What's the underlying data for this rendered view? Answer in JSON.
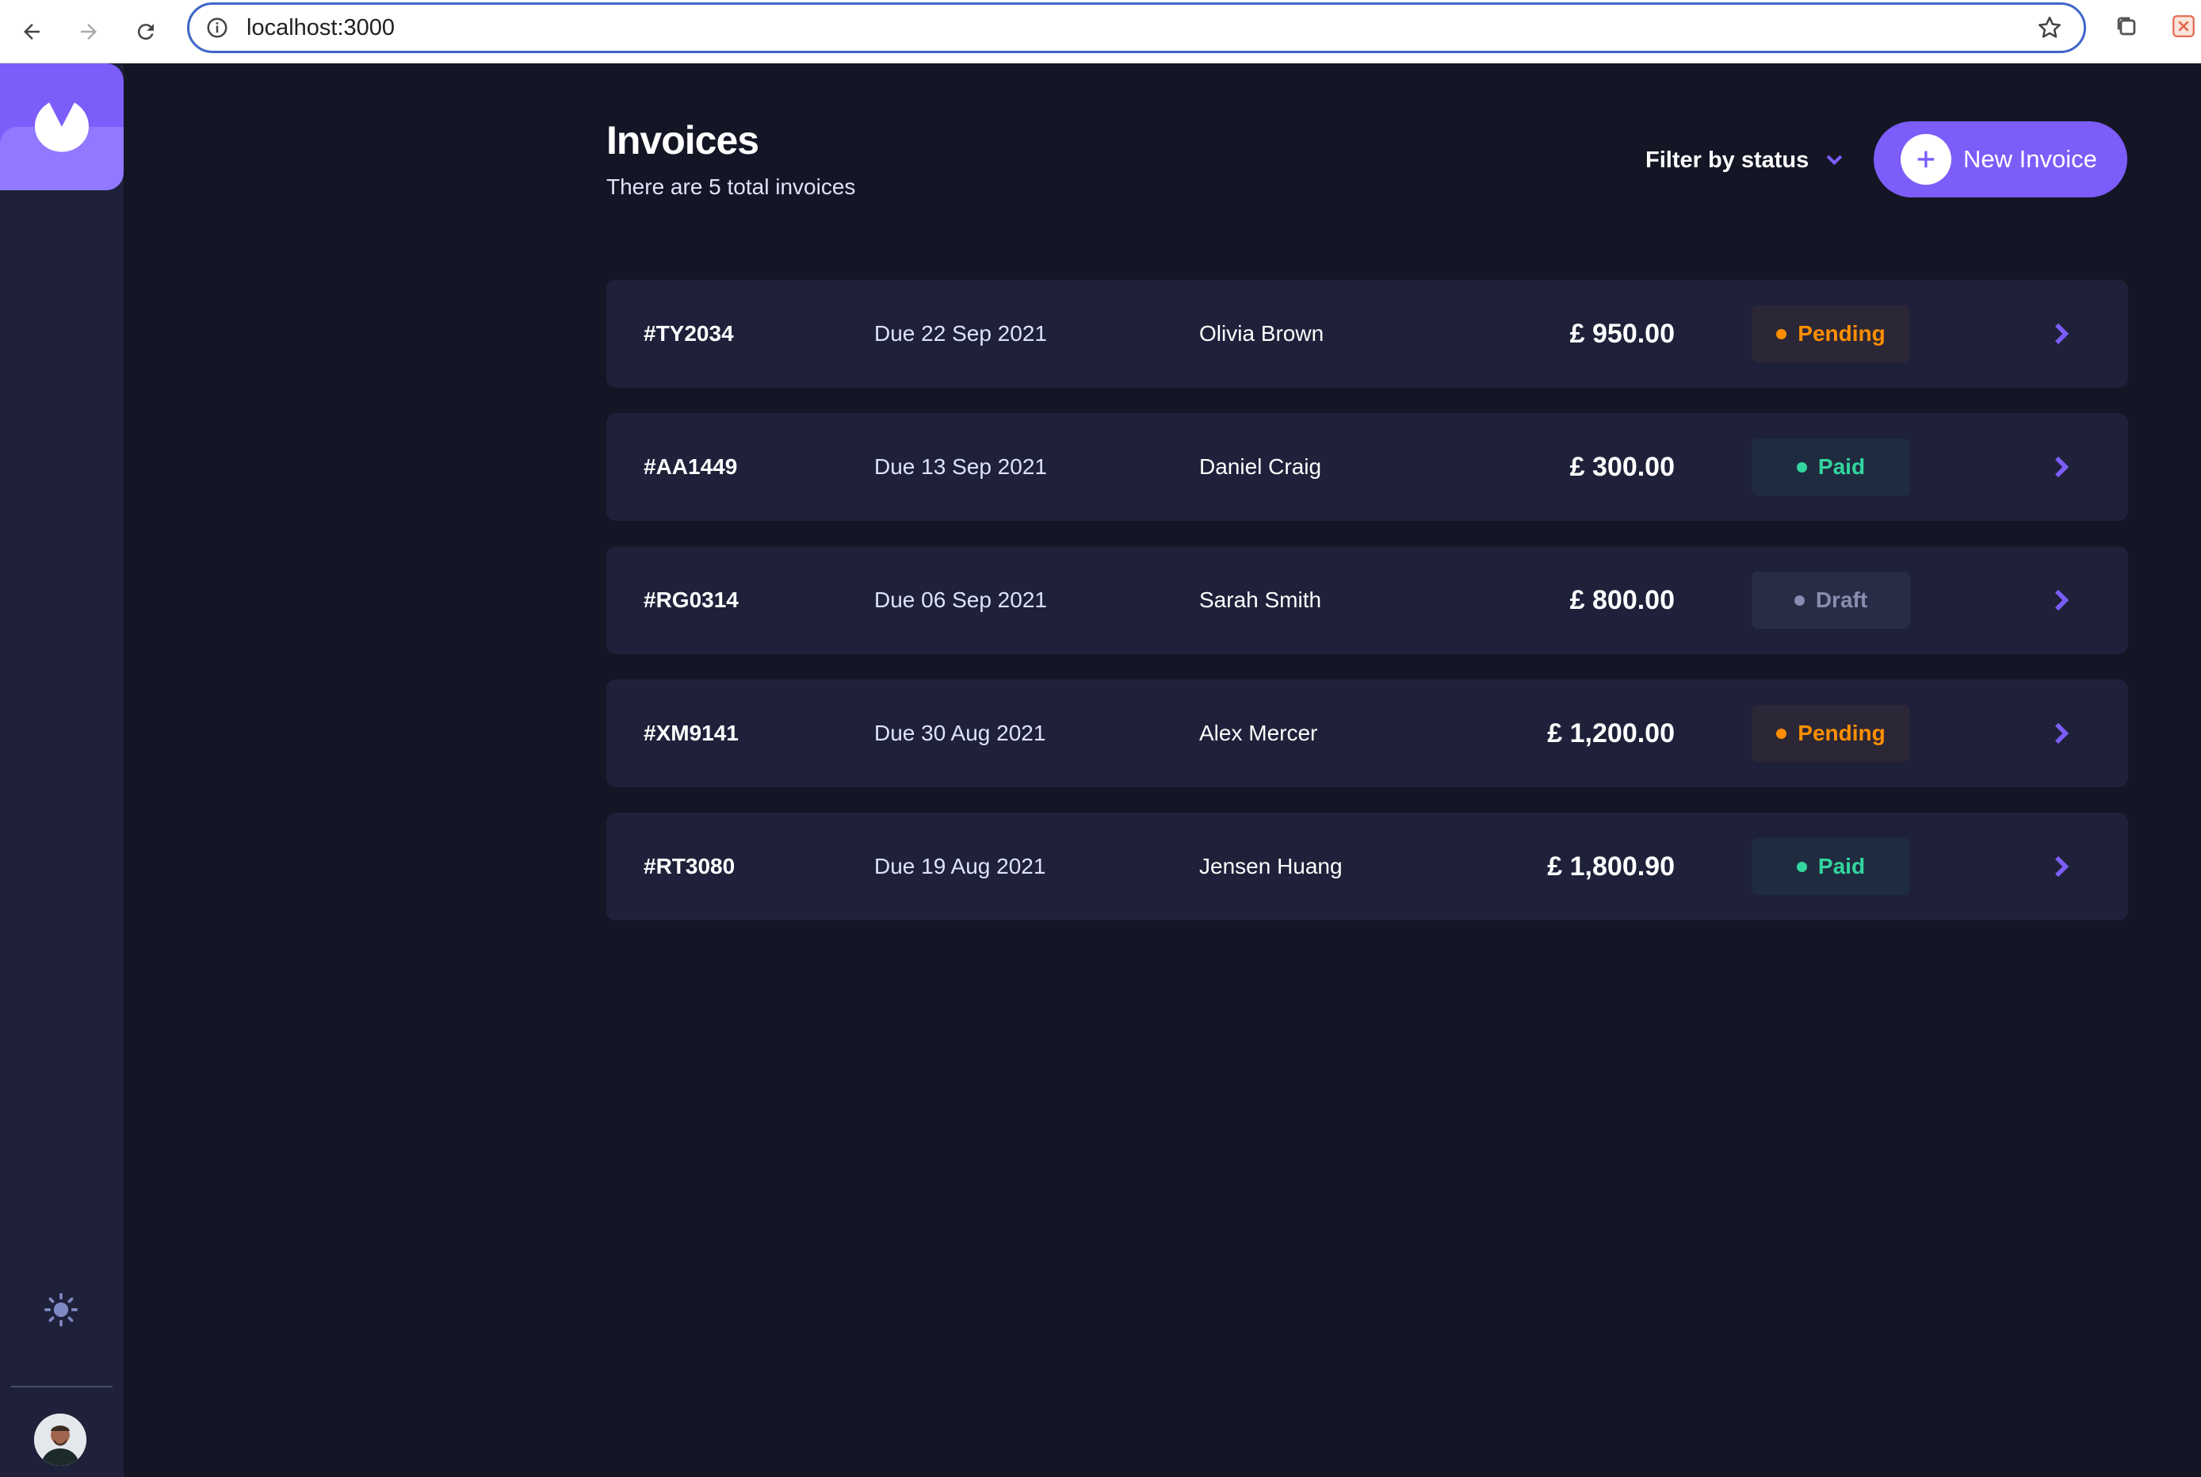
{
  "browser": {
    "url": "localhost:3000"
  },
  "header": {
    "title": "Invoices",
    "subtitle": "There are 5 total invoices",
    "filter_label": "Filter by status",
    "new_invoice_label": "New Invoice"
  },
  "invoices": [
    {
      "id_hash": "#",
      "id": "TY2034",
      "due": "Due 22 Sep 2021",
      "client": "Olivia Brown",
      "amount": "£ 950.00",
      "status": "Pending"
    },
    {
      "id_hash": "#",
      "id": "AA1449",
      "due": "Due 13 Sep 2021",
      "client": "Daniel Craig",
      "amount": "£ 300.00",
      "status": "Paid"
    },
    {
      "id_hash": "#",
      "id": "RG0314",
      "due": "Due 06 Sep 2021",
      "client": "Sarah Smith",
      "amount": "£ 800.00",
      "status": "Draft"
    },
    {
      "id_hash": "#",
      "id": "XM9141",
      "due": "Due 30 Aug 2021",
      "client": "Alex Mercer",
      "amount": "£ 1,200.00",
      "status": "Pending"
    },
    {
      "id_hash": "#",
      "id": "RT3080",
      "due": "Due 19 Aug 2021",
      "client": "Jensen Huang",
      "amount": "£ 1,800.90",
      "status": "Paid"
    }
  ],
  "icons": {
    "back": "back-arrow-icon",
    "forward": "forward-arrow-icon",
    "reload": "reload-icon",
    "info": "info-icon",
    "bookmark": "star-icon",
    "logo": "app-logo-icon",
    "theme": "sun-icon",
    "filter": "chevron-down-icon",
    "new": "plus-icon",
    "row": "chevron-right-icon"
  },
  "colors": {
    "background": "#141625",
    "card": "#1e2139",
    "accent": "#7c5dfa",
    "pending": "#ff8f00",
    "paid": "#33d69f",
    "draft": "#888eb0"
  }
}
